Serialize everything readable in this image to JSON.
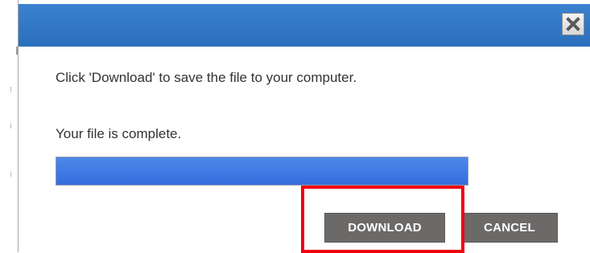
{
  "dialog": {
    "message": "Click 'Download' to save the file to your computer.",
    "status": "Your file is complete.",
    "progress_fraction": 1.0,
    "buttons": {
      "download_label": "DOWNLOAD",
      "cancel_label": "CANCEL"
    },
    "close_icon": "close-x-icon",
    "titlebar_color": "#2f75c4",
    "progress_color": "#3d77e3",
    "button_color": "#6c6a68",
    "highlight_color": "#f0000f"
  }
}
